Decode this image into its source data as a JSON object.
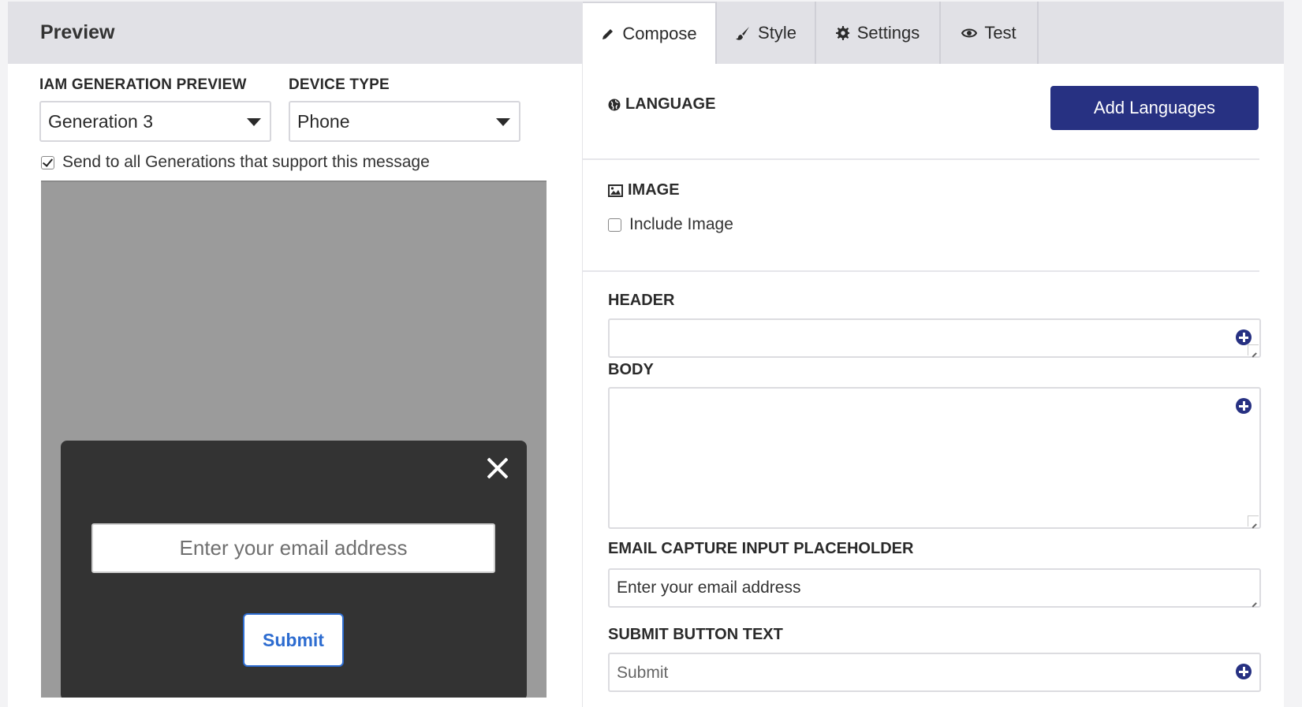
{
  "preview": {
    "title": "Preview",
    "generation_label": "IAM GENERATION PREVIEW",
    "generation_value": "Generation 3",
    "device_label": "DEVICE TYPE",
    "device_value": "Phone",
    "send_all_label": "Send to all Generations that support this message",
    "send_all_checked": true,
    "modal": {
      "email_placeholder": "Enter your email address",
      "submit_label": "Submit"
    }
  },
  "tabs": [
    {
      "label": "Compose",
      "icon": "pencil-icon",
      "active": true
    },
    {
      "label": "Style",
      "icon": "brush-icon",
      "active": false
    },
    {
      "label": "Settings",
      "icon": "gear-icon",
      "active": false
    },
    {
      "label": "Test",
      "icon": "eye-icon",
      "active": false
    }
  ],
  "compose": {
    "language_label": "LANGUAGE",
    "add_languages_label": "Add Languages",
    "image_label": "IMAGE",
    "include_image_label": "Include Image",
    "include_image_checked": false,
    "header_label": "HEADER",
    "header_value": "",
    "body_label": "BODY",
    "body_value": "",
    "email_placeholder_label": "EMAIL CAPTURE INPUT PLACEHOLDER",
    "email_placeholder_value": "Enter your email address",
    "submit_text_label": "SUBMIT BUTTON TEXT",
    "submit_text_value": "Submit"
  },
  "colors": {
    "accent": "#273182",
    "panel_header": "#e1e1e6",
    "modal_bg": "#333333",
    "submit_blue": "#2d6cd0"
  }
}
